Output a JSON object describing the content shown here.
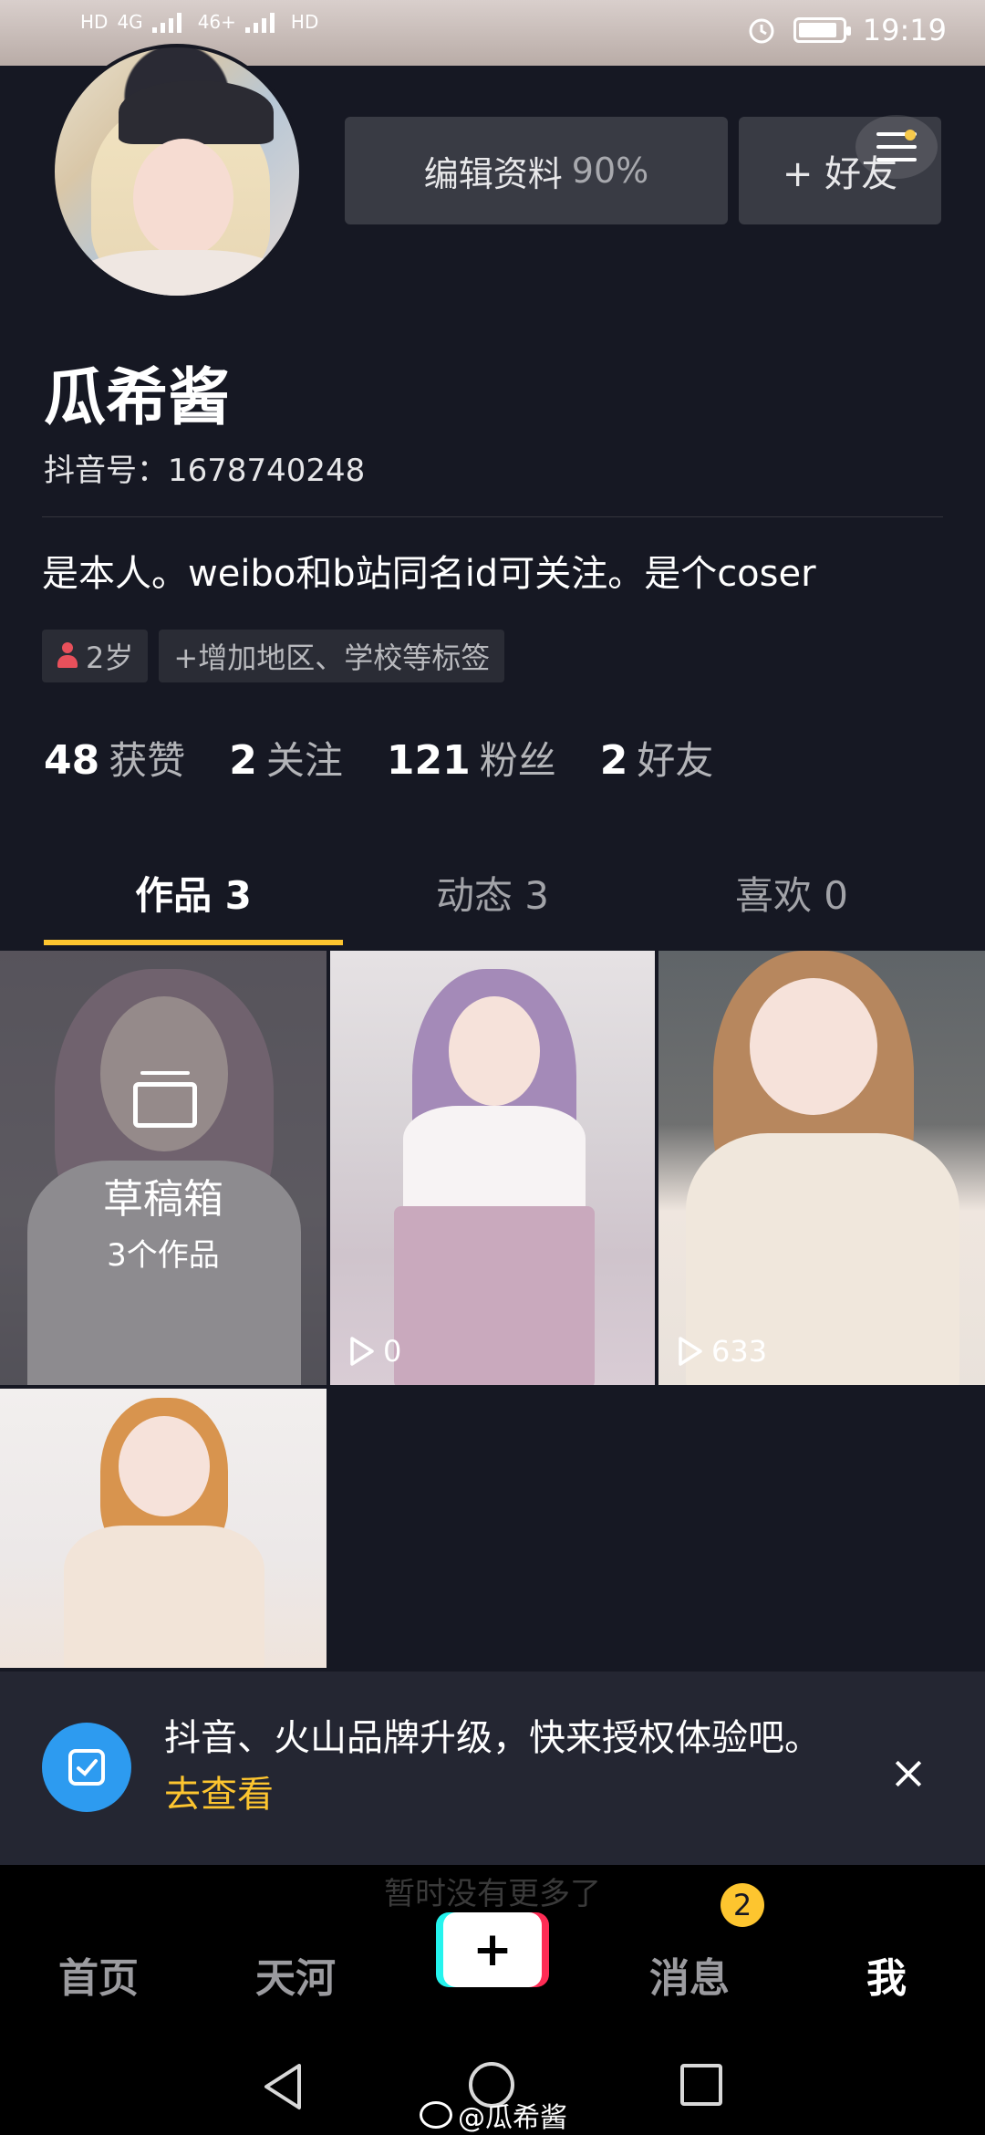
{
  "status_bar": {
    "left_indicators": [
      "HD",
      "4G",
      "46+",
      "HD"
    ],
    "time": "19:19",
    "battery_level": 0.9
  },
  "profile": {
    "nickname": "瓜希酱",
    "douyin_id_label": "抖音号：1678740248",
    "bio": "是本人。weibo和b站同名id可关注。是个coser",
    "edit_label": "编辑资料",
    "edit_percent": "90%",
    "add_friend_label": "+ 好友",
    "tags": {
      "age": "2岁",
      "add_tag": "+增加地区、学校等标签"
    }
  },
  "stats": [
    {
      "num": "48",
      "label": "获赞"
    },
    {
      "num": "2",
      "label": "关注"
    },
    {
      "num": "121",
      "label": "粉丝"
    },
    {
      "num": "2",
      "label": "好友"
    }
  ],
  "tabs": [
    {
      "label": "作品 3",
      "active": true
    },
    {
      "label": "动态 3",
      "active": false
    },
    {
      "label": "喜欢 0",
      "active": false
    }
  ],
  "grid": {
    "draft": {
      "title": "草稿箱",
      "count": "3个作品"
    },
    "videos": [
      {
        "plays": "0"
      },
      {
        "plays": "633"
      }
    ]
  },
  "banner": {
    "text": "抖音、火山品牌升级，快来授权体验吧。",
    "link": "去查看"
  },
  "bottom_nav": {
    "ghost_text": "暂时没有更多了",
    "items": [
      "首页",
      "天河",
      "消息",
      "我"
    ],
    "plus": "+",
    "message_badge": "2"
  },
  "watermark": "@瓜希酱",
  "colors": {
    "background": "#161823",
    "accent_yellow": "#fdc52f",
    "banner_blue": "#2d9bf0",
    "plus_cyan": "#25f4ee",
    "plus_red": "#fe2c55"
  },
  "icons": [
    "alarm-icon",
    "battery-icon",
    "menu-icon",
    "person-icon",
    "draft-box-icon",
    "play-icon",
    "auth-icon",
    "close-icon",
    "back-icon",
    "home-icon",
    "recent-apps-icon",
    "weibo-icon"
  ]
}
